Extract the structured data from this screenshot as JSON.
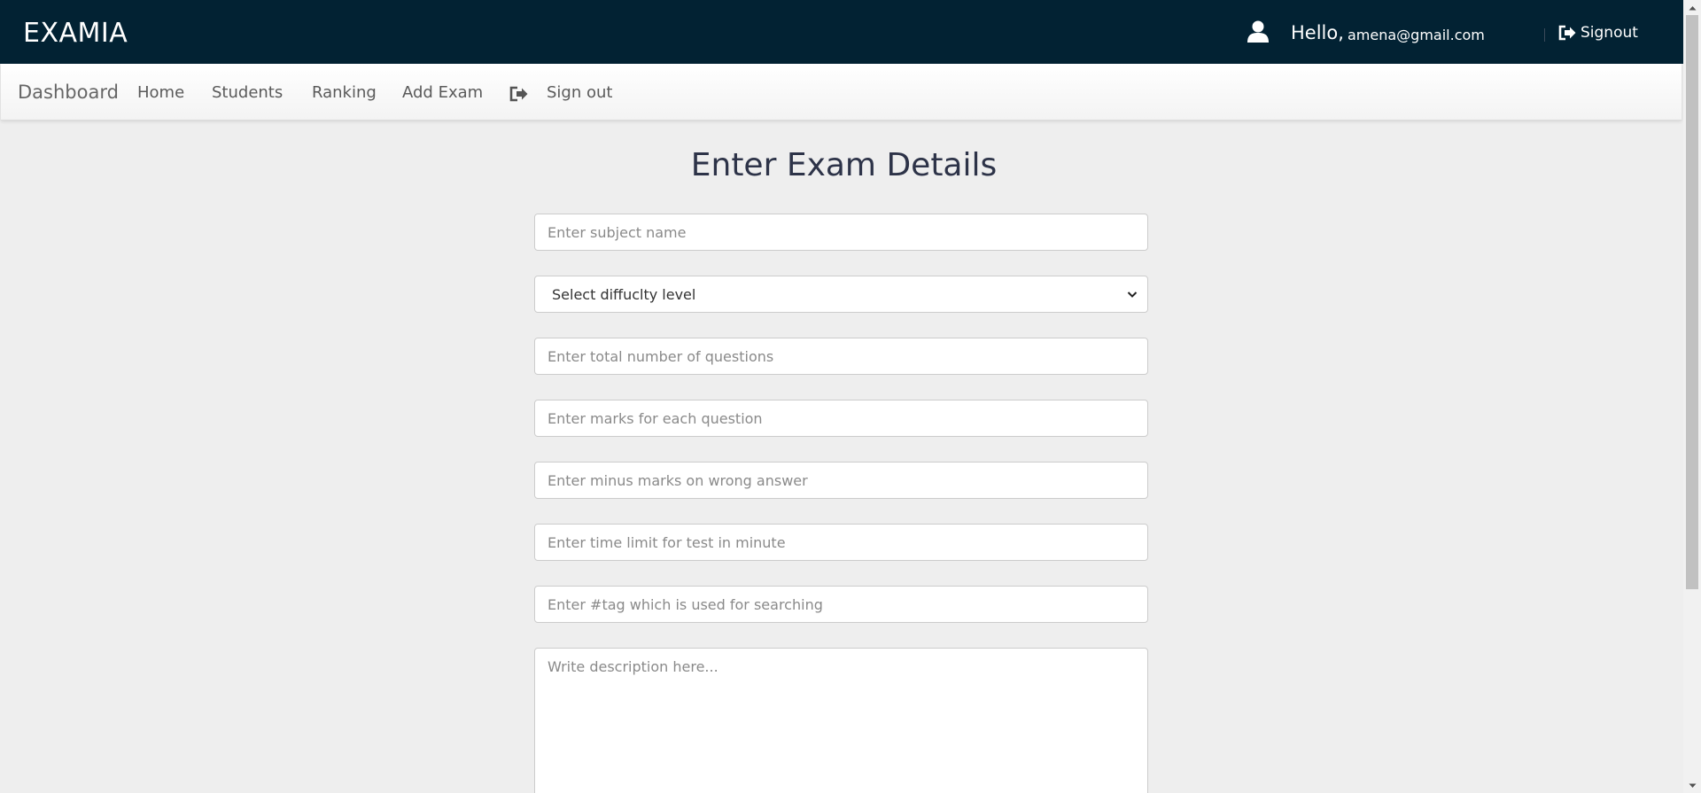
{
  "header": {
    "brand": "EXAMIA",
    "greeting": "Hello,",
    "email": "amena@gmail.com",
    "signout_label": "Signout"
  },
  "nav": {
    "brand": "Dashboard",
    "items": [
      {
        "label": "Home"
      },
      {
        "label": "Students"
      },
      {
        "label": "Ranking"
      },
      {
        "label": "Add Exam"
      }
    ],
    "signout_label": "Sign out"
  },
  "form": {
    "title": "Enter Exam Details",
    "subject_placeholder": "Enter subject name",
    "difficulty_selected": "Select diffuclty level",
    "total_questions_placeholder": "Enter total number of questions",
    "marks_placeholder": "Enter marks for each question",
    "minus_marks_placeholder": "Enter minus marks on wrong answer",
    "time_limit_placeholder": "Enter time limit for test in minute",
    "tag_placeholder": "Enter #tag which is used for searching",
    "description_placeholder": "Write description here..."
  },
  "colors": {
    "header_bg": "#022233",
    "page_bg": "#eeeeee",
    "title_color": "#2d3348"
  }
}
